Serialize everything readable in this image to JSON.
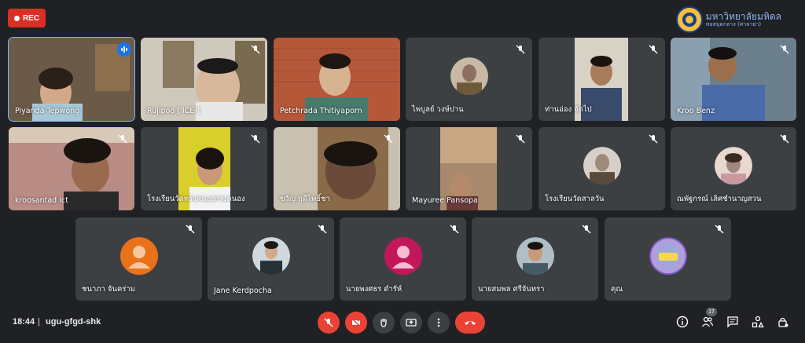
{
  "recording": {
    "label": "REC"
  },
  "logo": {
    "title": "มหาวิทยาลัยมหิดล",
    "subtitle": "ทอสมุดกลาง (ศาลายา)"
  },
  "participants": [
    {
      "name": "Piyanda Tepwong",
      "video": true,
      "speaking": true,
      "bg": "#6b5a48"
    },
    {
      "name": "Rujipoo [ ICE ]",
      "video": true,
      "bg": "#cfc8bc"
    },
    {
      "name": "Petchrada Thitiyaporn",
      "video": true,
      "bg": "#b5583a"
    },
    {
      "name": "ไพบูลย์ วงษ์ปาน",
      "video": false,
      "avatar_color": "#8d6e63"
    },
    {
      "name": "ท่านอ่อง จัดไป",
      "video": true,
      "bg": "#d8d2c6"
    },
    {
      "name": "Kroo Benz",
      "video": true,
      "bg": "#6b7f8c"
    },
    {
      "name": "kroosantad ict",
      "video": true,
      "bg": "#b98c86"
    },
    {
      "name": "โรงเรียนวัดทรงคนองกรงคนอง",
      "video": true,
      "bg": "#d9cf2a"
    },
    {
      "name": "ขวัญ ฤดีโพธิ์ชา",
      "video": true,
      "bg": "#8a6a48"
    },
    {
      "name": "Mayuree Pansopa",
      "video": true,
      "bg": "#a9896e"
    },
    {
      "name": "โรงเรียนวัดสาลวัน",
      "video": false,
      "avatar_color": "#9e8a78"
    },
    {
      "name": "ณพัฐกรณ์ เลิศชำนาญสวน",
      "video": false,
      "avatar_color": "#a1887f"
    },
    {
      "name": "ชนาภา จันคร่าม",
      "video": false,
      "avatar_color": "#e8711a"
    },
    {
      "name": "Jane Kerdpocha",
      "video": false,
      "avatar_color": "#37474f"
    },
    {
      "name": "นายพงศธร ดำรัห์",
      "video": false,
      "avatar_color": "#c2185b"
    },
    {
      "name": "นายสมพล ศรีจันทรา",
      "video": false,
      "avatar_color": "#455a64"
    },
    {
      "name": "คุณ",
      "video": false,
      "avatar_color": "#7e57c2"
    }
  ],
  "meeting": {
    "time": "18:44",
    "separator": "|",
    "code": "ugu-gfgd-shk"
  },
  "controls": [
    "mic-off",
    "camera-off",
    "raise-hand",
    "present",
    "more-options",
    "leave-call"
  ],
  "right_controls": [
    "info",
    "people",
    "chat",
    "activities",
    "host-controls"
  ],
  "people_count": "17",
  "colors": {
    "background": "#202124",
    "tile": "#3c4043",
    "danger": "#ea4335",
    "accent": "#8ab4f8"
  }
}
